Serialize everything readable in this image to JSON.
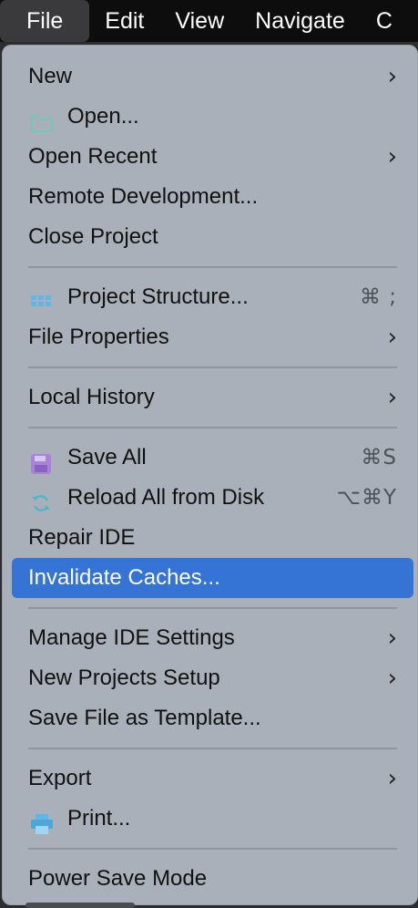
{
  "menubar": {
    "items": [
      {
        "label": "File"
      },
      {
        "label": "Edit"
      },
      {
        "label": "View"
      },
      {
        "label": "Navigate"
      },
      {
        "label": "C"
      }
    ]
  },
  "menu": {
    "items": [
      {
        "label": "New"
      },
      {
        "label": "Open..."
      },
      {
        "label": "Open Recent"
      },
      {
        "label": "Remote Development..."
      },
      {
        "label": "Close Project"
      },
      {
        "label": "Project Structure...",
        "shortcut": "⌘ ;"
      },
      {
        "label": "File Properties"
      },
      {
        "label": "Local History"
      },
      {
        "label": "Save All",
        "shortcut": "⌘S"
      },
      {
        "label": "Reload All from Disk",
        "shortcut": "⌥⌘Y"
      },
      {
        "label": "Repair IDE"
      },
      {
        "label": "Invalidate Caches..."
      },
      {
        "label": "Manage IDE Settings"
      },
      {
        "label": "New Projects Setup"
      },
      {
        "label": "Save File as Template..."
      },
      {
        "label": "Export"
      },
      {
        "label": "Print..."
      },
      {
        "label": "Power Save Mode"
      }
    ]
  },
  "icons": {
    "open": "folder-icon",
    "project_structure": "grid-icon",
    "save_all": "save-icon",
    "reload": "reload-icon",
    "print": "printer-icon"
  },
  "colors": {
    "menubar_bg": "#0d0d0d",
    "menu_bg": "#aab0b9",
    "selection": "#3574d4"
  }
}
